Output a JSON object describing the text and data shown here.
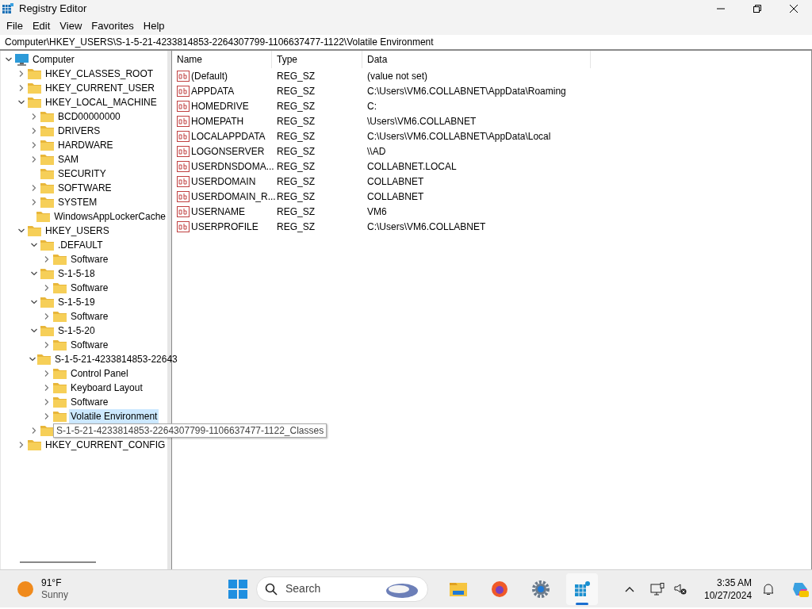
{
  "window": {
    "title": "Registry Editor"
  },
  "menu": [
    "File",
    "Edit",
    "View",
    "Favorites",
    "Help"
  ],
  "address": "Computer\\HKEY_USERS\\S-1-5-21-4233814853-2264307799-1106637477-1122\\Volatile Environment",
  "tree": [
    {
      "label": "Computer",
      "kind": "computer",
      "expanded": true,
      "selected": false,
      "children": [
        {
          "label": "HKEY_CLASSES_ROOT",
          "kind": "folder",
          "expanded": false,
          "selected": false
        },
        {
          "label": "HKEY_CURRENT_USER",
          "kind": "folder",
          "expanded": false,
          "selected": false
        },
        {
          "label": "HKEY_LOCAL_MACHINE",
          "kind": "folder",
          "expanded": true,
          "selected": false,
          "children": [
            {
              "label": "BCD00000000",
              "kind": "folder",
              "expanded": false,
              "selected": false
            },
            {
              "label": "DRIVERS",
              "kind": "folder",
              "expanded": false,
              "selected": false
            },
            {
              "label": "HARDWARE",
              "kind": "folder",
              "expanded": false,
              "selected": false
            },
            {
              "label": "SAM",
              "kind": "folder",
              "expanded": false,
              "selected": false
            },
            {
              "label": "SECURITY",
              "kind": "folder",
              "selected": false
            },
            {
              "label": "SOFTWARE",
              "kind": "folder",
              "expanded": false,
              "selected": false
            },
            {
              "label": "SYSTEM",
              "kind": "folder",
              "expanded": false,
              "selected": false
            },
            {
              "label": "WindowsAppLockerCache",
              "kind": "folder",
              "selected": false
            }
          ]
        },
        {
          "label": "HKEY_USERS",
          "kind": "folder",
          "expanded": true,
          "selected": false,
          "children": [
            {
              "label": ".DEFAULT",
              "kind": "folder",
              "expanded": true,
              "selected": false,
              "children": [
                {
                  "label": "Software",
                  "kind": "folder",
                  "expanded": false,
                  "selected": false
                }
              ]
            },
            {
              "label": "S-1-5-18",
              "kind": "folder",
              "expanded": true,
              "selected": false,
              "children": [
                {
                  "label": "Software",
                  "kind": "folder",
                  "expanded": false,
                  "selected": false
                }
              ]
            },
            {
              "label": "S-1-5-19",
              "kind": "folder",
              "expanded": true,
              "selected": false,
              "children": [
                {
                  "label": "Software",
                  "kind": "folder",
                  "expanded": false,
                  "selected": false
                }
              ]
            },
            {
              "label": "S-1-5-20",
              "kind": "folder",
              "expanded": true,
              "selected": false,
              "children": [
                {
                  "label": "Software",
                  "kind": "folder",
                  "expanded": false,
                  "selected": false
                }
              ]
            },
            {
              "label": "S-1-5-21-4233814853-22643",
              "kind": "folder",
              "expanded": true,
              "selected": false,
              "children": [
                {
                  "label": "Control Panel",
                  "kind": "folder",
                  "expanded": false,
                  "selected": false
                },
                {
                  "label": "Keyboard Layout",
                  "kind": "folder",
                  "expanded": false,
                  "selected": false
                },
                {
                  "label": "Software",
                  "kind": "folder",
                  "expanded": false,
                  "selected": false
                },
                {
                  "label": "Volatile Environment",
                  "kind": "folder",
                  "expanded": false,
                  "selected": true
                }
              ]
            },
            {
              "tooltip": "S-1-5-21-4233814853-2264307799-1106637477-1122_Classes",
              "kind": "folder",
              "expanded": false,
              "selected": false
            }
          ]
        },
        {
          "label": "HKEY_CURRENT_CONFIG",
          "kind": "folder",
          "expanded": false,
          "selected": false
        }
      ]
    }
  ],
  "columns": [
    "Name",
    "Type",
    "Data"
  ],
  "rows": [
    {
      "name": "(Default)",
      "type": "REG_SZ",
      "data": "(value not set)"
    },
    {
      "name": "APPDATA",
      "type": "REG_SZ",
      "data": "C:\\Users\\VM6.COLLABNET\\AppData\\Roaming"
    },
    {
      "name": "HOMEDRIVE",
      "type": "REG_SZ",
      "data": "C:"
    },
    {
      "name": "HOMEPATH",
      "type": "REG_SZ",
      "data": "\\Users\\VM6.COLLABNET"
    },
    {
      "name": "LOCALAPPDATA",
      "type": "REG_SZ",
      "data": "C:\\Users\\VM6.COLLABNET\\AppData\\Local"
    },
    {
      "name": "LOGONSERVER",
      "type": "REG_SZ",
      "data": "\\\\AD"
    },
    {
      "name": "USERDNSDOMA...",
      "type": "REG_SZ",
      "data": "COLLABNET.LOCAL"
    },
    {
      "name": "USERDOMAIN",
      "type": "REG_SZ",
      "data": "COLLABNET"
    },
    {
      "name": "USERDOMAIN_R...",
      "type": "REG_SZ",
      "data": "COLLABNET"
    },
    {
      "name": "USERNAME",
      "type": "REG_SZ",
      "data": "VM6"
    },
    {
      "name": "USERPROFILE",
      "type": "REG_SZ",
      "data": "C:\\Users\\VM6.COLLABNET"
    }
  ],
  "taskbar": {
    "weather": {
      "temp": "91°F",
      "condition": "Sunny"
    },
    "search": {
      "placeholder": "Search"
    },
    "apps": [
      {
        "kind": "explorer",
        "active": false
      },
      {
        "kind": "firefox",
        "active": false
      },
      {
        "kind": "settings",
        "active": false
      },
      {
        "kind": "regedit",
        "active": true
      }
    ],
    "time": "3:35 AM",
    "date": "10/27/2024"
  }
}
